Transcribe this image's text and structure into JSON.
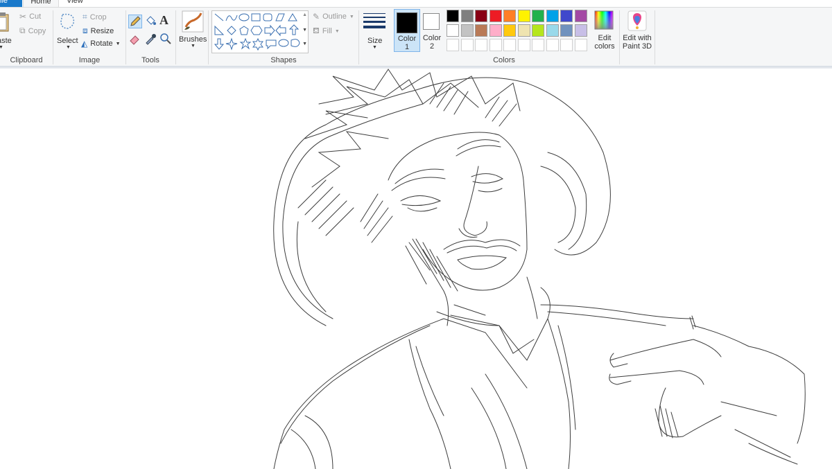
{
  "tabs": [
    {
      "label": "ile"
    },
    {
      "label": "Home"
    },
    {
      "label": "View"
    }
  ],
  "clipboard": {
    "paste": "aste",
    "cut": "Cut",
    "copy": "Copy",
    "group": "Clipboard"
  },
  "image": {
    "select": "Select",
    "crop": "Crop",
    "resize": "Resize",
    "rotate": "Rotate",
    "group": "Image"
  },
  "tools": {
    "group": "Tools"
  },
  "brushes": {
    "label": "Brushes"
  },
  "shapes": {
    "outline": "Outline",
    "fill": "Fill",
    "group": "Shapes"
  },
  "size": {
    "label": "Size"
  },
  "colors": {
    "color1": "Color 1",
    "color2": "Color 2",
    "color1_value": "#000000",
    "color2_value": "#ffffff",
    "edit": "Edit colors",
    "group": "Colors",
    "palette_row1": [
      "#000000",
      "#7f7f7f",
      "#880015",
      "#ed1c24",
      "#ff7f27",
      "#fff200",
      "#22b14c",
      "#00a2e8",
      "#3f48cc",
      "#a349a4"
    ],
    "palette_row2": [
      "#ffffff",
      "#c3c3c3",
      "#b97a57",
      "#ffaec9",
      "#ffc90e",
      "#efe4b0",
      "#b5e61d",
      "#99d9ea",
      "#7092be",
      "#c8bfe7"
    ]
  },
  "paint3d": {
    "label": "Edit with Paint 3D"
  }
}
